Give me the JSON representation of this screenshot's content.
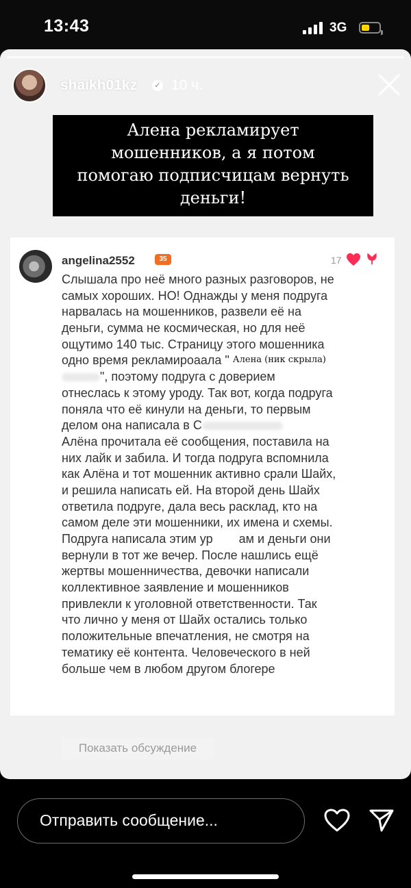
{
  "status_bar": {
    "time": "13:43",
    "network": "3G",
    "battery_level": 0.45,
    "battery_color": "#ffd60a",
    "signal_bars": 4
  },
  "story": {
    "username": "shaikh01kz",
    "verified": true,
    "time_ago": "10 ч.",
    "close_icon": "close-icon",
    "caption_lines": [
      "Алена рекламирует",
      "мошенников, а я потом",
      "помогаю подписчицам вернуть",
      "деньги!"
    ]
  },
  "comment": {
    "username": "angelina2552",
    "level": "35",
    "level_color": "#f06d22",
    "likes": "17",
    "annotation": "Алена (ник скрыла)",
    "lines": [
      "Слышала про неё много разных разговоров, не",
      "самых хороших. НО! Однажды у меня подруга",
      "нарвалась на мошенников, развели её на",
      "деньги, сумма не космическая, но для неё",
      "ощутимо 140 тыс. Страницу этого мошенника",
      "одно время рекламироаала \"",
      "\", поэтому подруга с доверием",
      "отнеслась к этому уроду. Так вот, когда подруга",
      "поняла что её кинули на деньги, то первым",
      "делом она написала в С",
      "Алёна прочитала её сообщения, поставила на",
      "них лайк и забила. И тогда подруга вспомнила",
      "как Алёна и тот мошенник активно срали Шайх,",
      "и решила написать ей. На второй день Шайх",
      "ответила подруге, дала весь расклад, кто на",
      "самом деле эти мошенники, их имена и схемы.",
      "Подруга написала этим ур",
      "ам и деньги они",
      "вернули в тот же вечер. После нашлись ещё",
      "жертвы мошенничества, девочки написали",
      "коллективное заявление и мошенников",
      "привлекли к уголовной ответственности. Так",
      "что лично у меня от Шайх остались только",
      "положительные впечатления, не смотря на",
      "тематику её контента. Человеческого в ней",
      "больше чем в любом другом блогере"
    ],
    "show_discussion": "Показать обсуждение"
  },
  "bottom_bar": {
    "message_placeholder": "Отправить сообщение...",
    "heart_icon": "heart-icon",
    "send_icon": "send-icon"
  }
}
